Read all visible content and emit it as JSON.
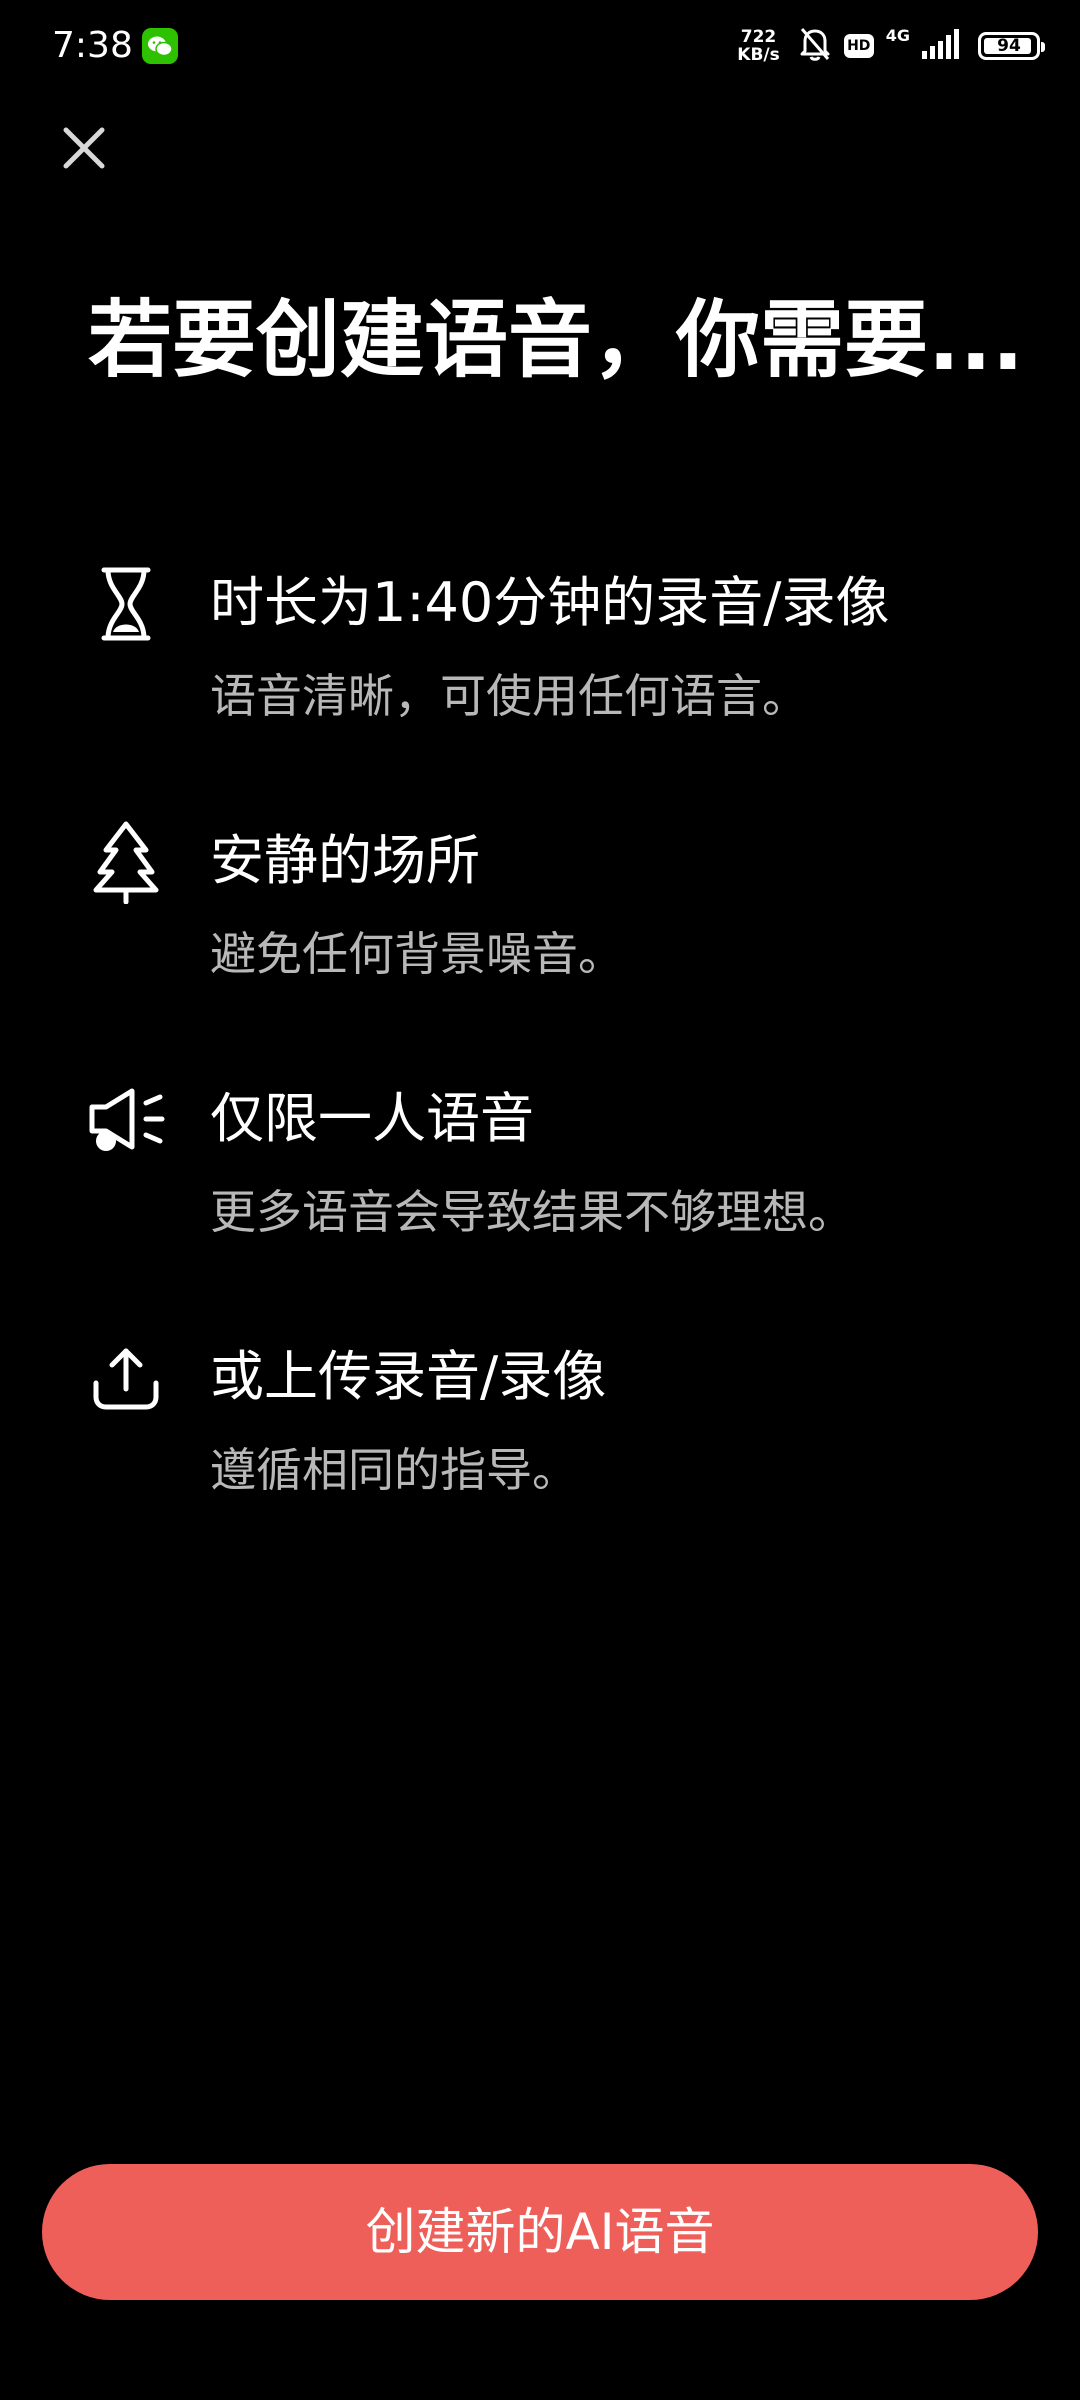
{
  "status_bar": {
    "time": "7:38",
    "net_speed_value": "722",
    "net_speed_unit": "KB/s",
    "hd_label": "HD",
    "network_type": "4G",
    "battery_level": "94",
    "battery_fraction": 0.94,
    "app_notification_icon": "wechat-icon"
  },
  "header": {
    "close_icon": "close-icon",
    "title": "若要创建语音，你需要..."
  },
  "requirements": [
    {
      "icon": "hourglass-icon",
      "title": "时长为1:40分钟的录音/录像",
      "description": "语音清晰，可使用任何语言。"
    },
    {
      "icon": "tree-icon",
      "title": "安静的场所",
      "description": "避免任何背景噪音。"
    },
    {
      "icon": "megaphone-icon",
      "title": "仅限一人语音",
      "description": "更多语音会导致结果不够理想。"
    },
    {
      "icon": "upload-icon",
      "title": "或上传录音/录像",
      "description": "遵循相同的指导。"
    }
  ],
  "cta": {
    "label": "创建新的AI语音",
    "color": "#ef5f5a"
  }
}
